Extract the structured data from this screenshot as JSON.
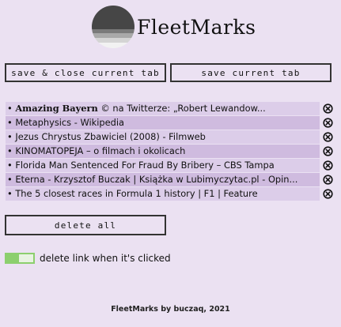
{
  "header": {
    "title": "FleetMarks",
    "logo_icon": "striped-circle-logo"
  },
  "buttons": {
    "save_close": "save & close current tab",
    "save": "save current tab",
    "delete_all": "delete all"
  },
  "links": [
    {
      "bullet": "•",
      "bold": "Amazing Bayern",
      "text": " © na Twitterze: „Robert Lewandow..."
    },
    {
      "bullet": "•",
      "bold": "",
      "text": "Metaphysics - Wikipedia"
    },
    {
      "bullet": "•",
      "bold": "",
      "text": "Jezus Chrystus Zbawiciel (2008) - Filmweb"
    },
    {
      "bullet": "•",
      "bold": "",
      "text": "KINOMATOPEJA – o filmach i okolicach"
    },
    {
      "bullet": "•",
      "bold": "",
      "text": "Florida Man Sentenced For Fraud By Bribery – CBS Tampa"
    },
    {
      "bullet": "•",
      "bold": "",
      "text": "Eterna - Krzysztof Buczak | Książka w Lubimyczytac.pl - Opin..."
    },
    {
      "bullet": "•",
      "bold": "",
      "text": "The 5 closest races in Formula 1 history  | F1 | Feature"
    }
  ],
  "delete_icon": "circle-x-icon",
  "toggle": {
    "label": "delete link when it's clicked",
    "state": "on",
    "color": "#8ccf6e"
  },
  "footer": {
    "text": "FleetMarks by buczaq, 2021"
  },
  "colors": {
    "background": "#ebe1f2",
    "row_light": "#dccde9",
    "row_dark": "#cfbbdf"
  }
}
